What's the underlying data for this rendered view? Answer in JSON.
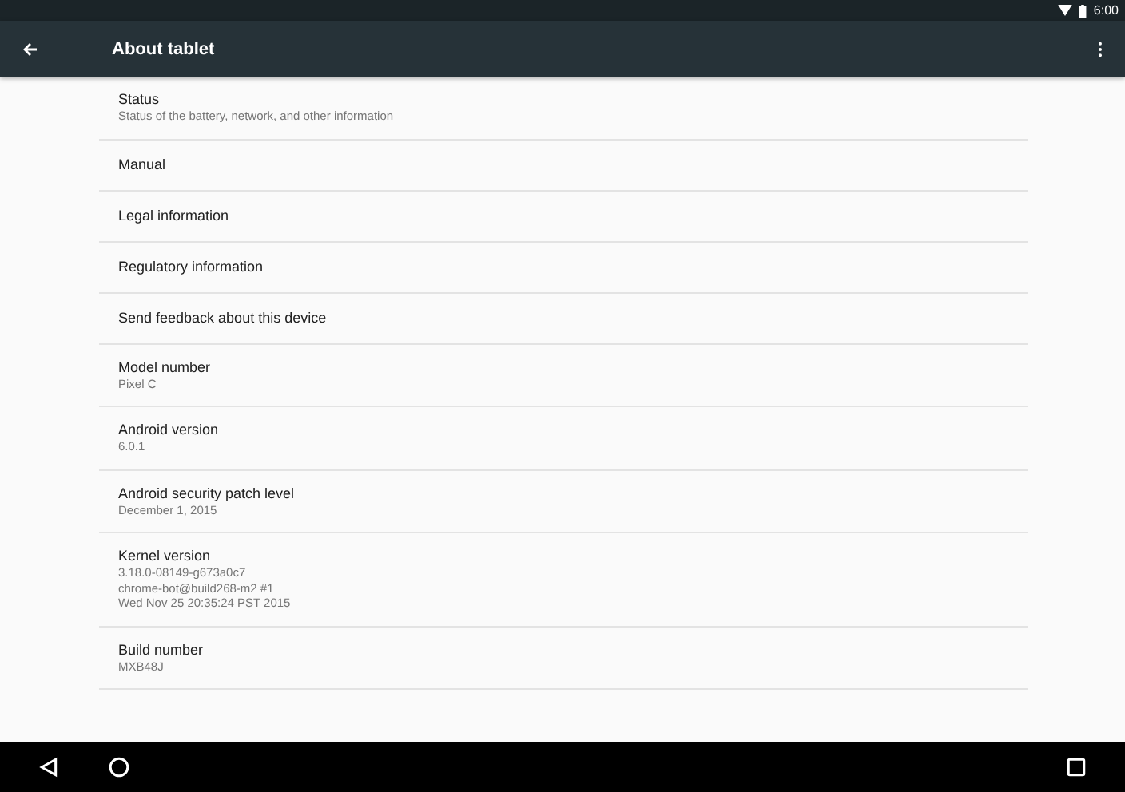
{
  "status_bar": {
    "time": "6:00"
  },
  "app_bar": {
    "title": "About tablet"
  },
  "items": [
    {
      "title": "Status",
      "summary": [
        "Status of the battery, network, and other information"
      ]
    },
    {
      "title": "Manual"
    },
    {
      "title": "Legal information"
    },
    {
      "title": "Regulatory information"
    },
    {
      "title": "Send feedback about this device"
    },
    {
      "title": "Model number",
      "summary": [
        "Pixel C"
      ]
    },
    {
      "title": "Android version",
      "summary": [
        "6.0.1"
      ]
    },
    {
      "title": "Android security patch level",
      "summary": [
        "December 1, 2015"
      ]
    },
    {
      "title": "Kernel version",
      "summary": [
        "3.18.0-08149-g673a0c7",
        "chrome-bot@build268-m2 #1",
        "Wed Nov 25 20:35:24 PST 2015"
      ]
    },
    {
      "title": "Build number",
      "summary": [
        "MXB48J"
      ]
    }
  ]
}
